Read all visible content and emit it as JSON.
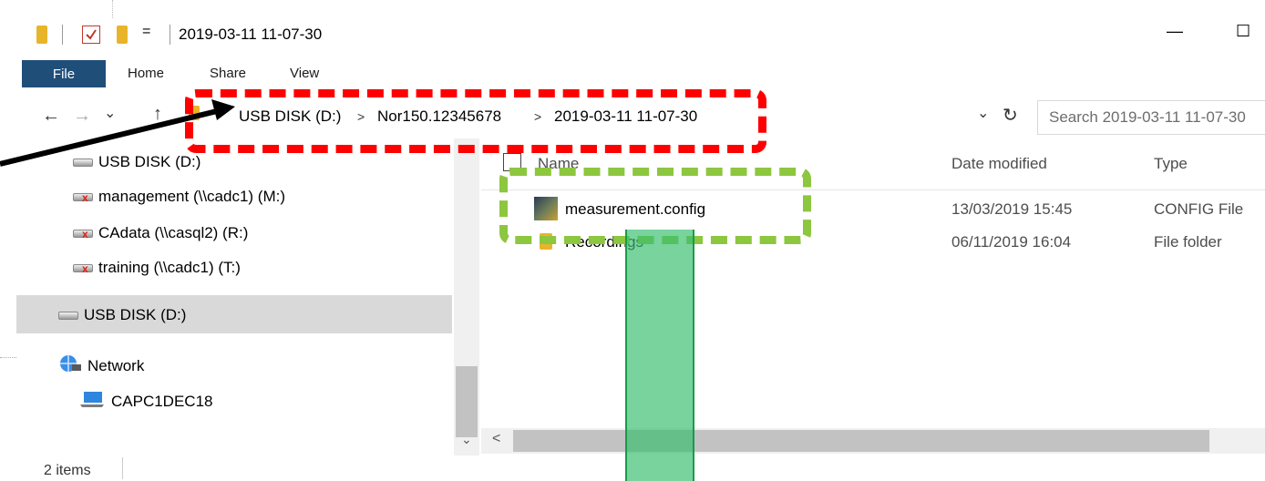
{
  "window": {
    "title": "2019-03-11 11-07-30",
    "qat_dropdown": "=",
    "minimize": "—",
    "maximize": "☐"
  },
  "ribbon": {
    "tabs": [
      "File",
      "Home",
      "Share",
      "View"
    ]
  },
  "address": {
    "back": "←",
    "forward": "→",
    "recent": "⌄",
    "up": "↑",
    "crumbs": [
      "USB DISK (D:)",
      "Nor150.12345678",
      "2019-03-11 11-07-30"
    ],
    "crumb_sep": ">",
    "dropdown": "⌄",
    "refresh": "↻",
    "search_placeholder": "Search 2019-03-11 11-07-30"
  },
  "nav": {
    "items": [
      {
        "label": "USB DISK (D:)",
        "icon": "drive-icon"
      },
      {
        "label": "management (\\\\cadc1) (M:)",
        "icon": "disconnected-network-drive-icon"
      },
      {
        "label": "CAdata (\\\\casql2) (R:)",
        "icon": "disconnected-network-drive-icon"
      },
      {
        "label": "training (\\\\cadc1) (T:)",
        "icon": "disconnected-network-drive-icon"
      },
      {
        "label": "USB DISK (D:)",
        "icon": "drive-icon",
        "selected": true
      },
      {
        "label": "Network",
        "icon": "network-icon"
      },
      {
        "label": "CAPC1DEC18",
        "icon": "computer-icon"
      }
    ],
    "scroll_up": "^",
    "scroll_down": "⌄"
  },
  "files": {
    "headers": {
      "name": "Name",
      "date": "Date modified",
      "type": "Type"
    },
    "rows": [
      {
        "name": "measurement.config",
        "date": "13/03/2019 15:45",
        "type": "CONFIG File",
        "icon": "config-file-icon"
      },
      {
        "name": "Recordings",
        "date": "06/11/2019 16:04",
        "type": "File folder",
        "icon": "folder-icon"
      }
    ],
    "scroll_left": "<"
  },
  "status": {
    "count": "2 items"
  },
  "colors": {
    "annotation_red": "#ff0000",
    "annotation_green": "#8dc63f",
    "highlight_bar": "#38be6e",
    "file_tab": "#1f4e79",
    "selected_nav": "#d9d9d9"
  }
}
